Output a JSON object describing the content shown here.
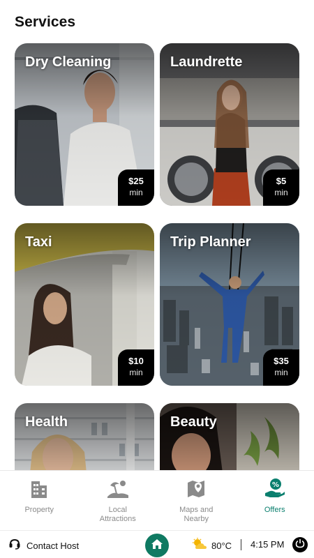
{
  "page": {
    "title": "Services"
  },
  "services": [
    {
      "title": "Dry Cleaning",
      "price": "$25",
      "unit": "min"
    },
    {
      "title": "Laundrette",
      "price": "$5",
      "unit": "min"
    },
    {
      "title": "Taxi",
      "price": "$10",
      "unit": "min"
    },
    {
      "title": "Trip Planner",
      "price": "$35",
      "unit": "min"
    },
    {
      "title": "Health"
    },
    {
      "title": "Beauty"
    }
  ],
  "nav": {
    "items": [
      {
        "label": "Property",
        "icon": "building-icon"
      },
      {
        "label": "Local Attractions",
        "icon": "beach-icon"
      },
      {
        "label": "Maps and Nearby",
        "icon": "map-icon"
      },
      {
        "label": "Offers",
        "icon": "offers-icon",
        "active": true
      }
    ]
  },
  "bottom_bar": {
    "contact_label": "Contact Host",
    "temperature": "80°C",
    "time": "4:15 PM"
  },
  "colors": {
    "accent": "#0a7f6e",
    "home_button": "#0f7a62",
    "price_badge": "#000000"
  }
}
